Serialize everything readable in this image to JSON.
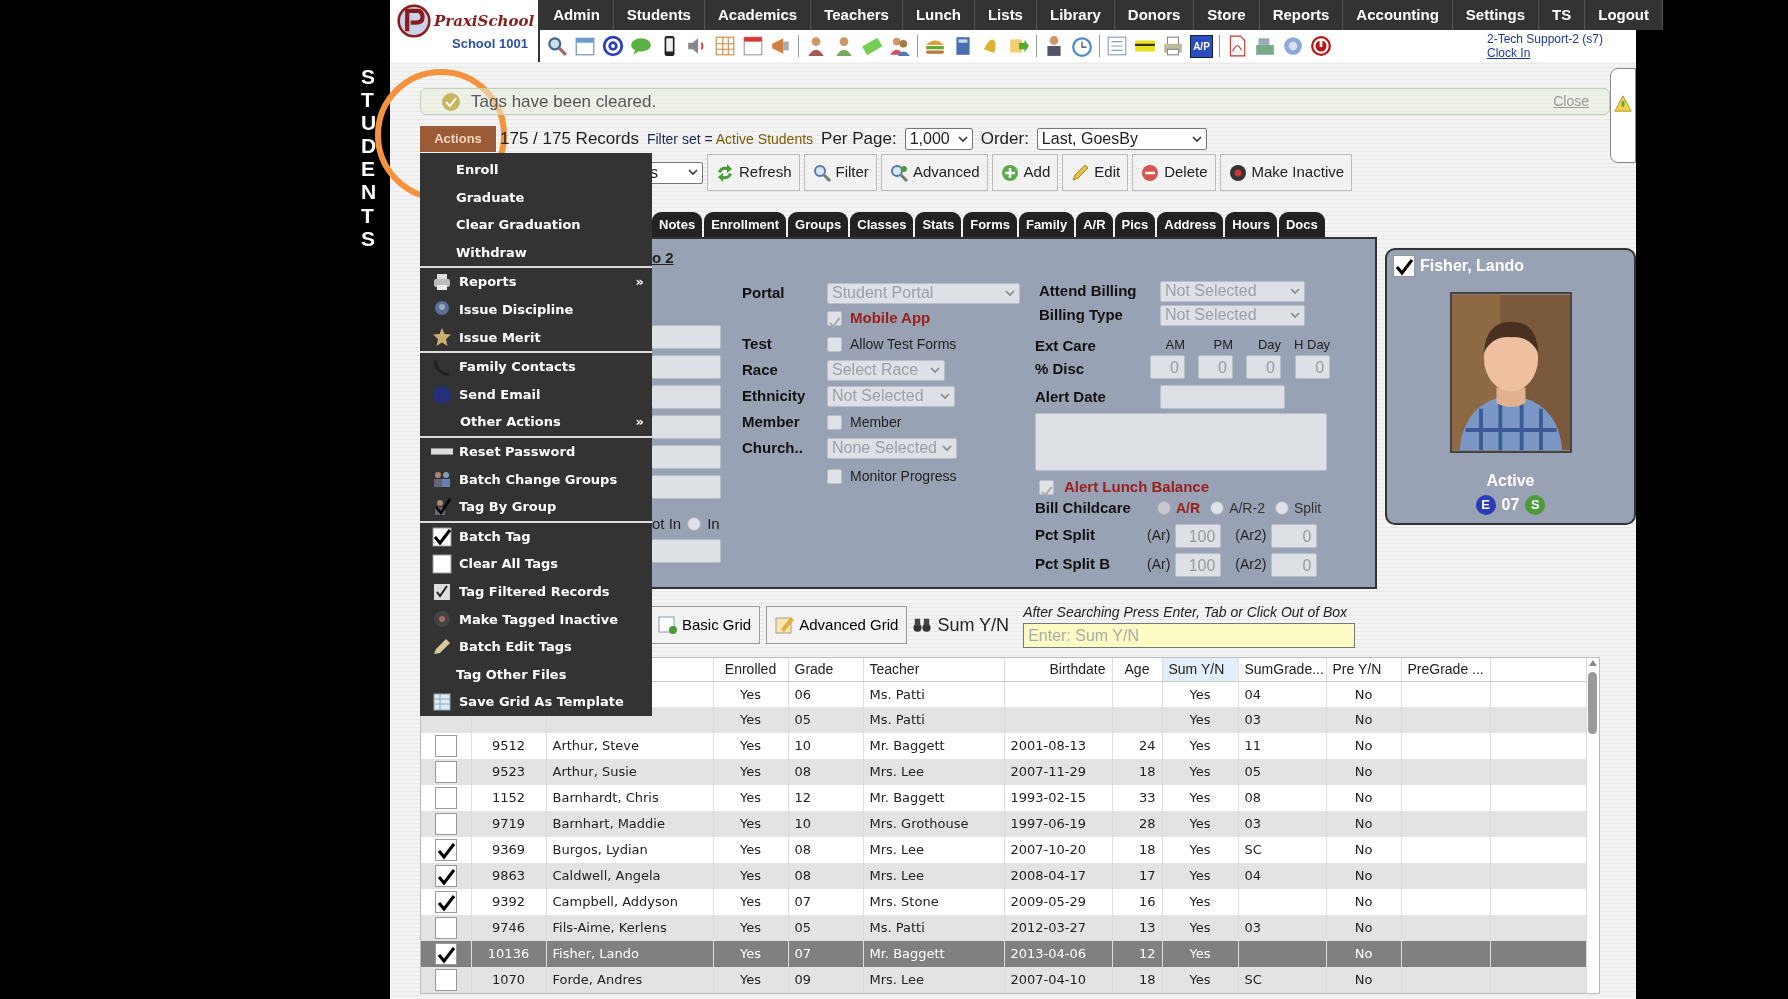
{
  "section_label": "STUDENTS",
  "logo": {
    "brand": "PraxiSchool",
    "school": "School 1001"
  },
  "nav": [
    "Admin",
    "Students",
    "Academics",
    "Teachers",
    "Lunch",
    "Lists",
    "Library",
    "Donors",
    "Store",
    "Reports",
    "Accounting",
    "Settings",
    "TS",
    "Logout"
  ],
  "toolbar": {
    "ap_label": "A/P"
  },
  "user": {
    "name": "2-Tech Support-2 (s7)",
    "clock_in": "Clock In"
  },
  "notification": {
    "message": "Tags have been cleared.",
    "close": "Close"
  },
  "records": {
    "actions": "Actions",
    "count": "175",
    "total": "/ 175 Records",
    "filter_label": "Filter set =",
    "filter_value": "Active Students",
    "per_page_label": "Per Page:",
    "per_page": "1,000",
    "order_label": "Order:",
    "order": "Last, GoesBy"
  },
  "view_select": "s",
  "buttons": [
    "Refresh",
    "Filter",
    "Advanced",
    "Add",
    "Edit",
    "Delete",
    "Make Inactive"
  ],
  "actions_menu": [
    [
      {
        "label": "Enroll"
      },
      {
        "label": "Graduate"
      },
      {
        "label": "Clear Graduation"
      },
      {
        "label": "Withdraw"
      }
    ],
    [
      {
        "label": "Reports",
        "arrow": "»"
      },
      {
        "label": "Issue Discipline"
      },
      {
        "label": "Issue Merit"
      }
    ],
    [
      {
        "label": "Family Contacts"
      },
      {
        "label": "Send Email"
      },
      {
        "label": "Other Actions",
        "arrow": "»"
      }
    ],
    [
      {
        "label": "Reset Password"
      },
      {
        "label": "Batch Change Groups"
      },
      {
        "label": "Tag By Group"
      }
    ],
    [
      {
        "label": "Batch Tag"
      },
      {
        "label": "Clear All Tags"
      },
      {
        "label": "Tag Filtered Records"
      },
      {
        "label": "Make Tagged Inactive"
      },
      {
        "label": "Batch Edit Tags"
      },
      {
        "label": "Tag Other Files"
      },
      {
        "label": "Save Grid As Template"
      }
    ]
  ],
  "tabs": [
    {
      "label": "Notes",
      "selected": false
    },
    {
      "label": "Enrollment",
      "selected": false
    },
    {
      "label": "Groups",
      "selected": false
    },
    {
      "label": "Classes",
      "selected": false
    },
    {
      "label": "Stats",
      "selected": false
    },
    {
      "label": "Forms",
      "selected": false
    },
    {
      "label": "Family",
      "selected": false
    },
    {
      "label": "A/R",
      "selected": false
    },
    {
      "label": "Pics",
      "selected": false
    },
    {
      "label": "Address",
      "selected": false
    },
    {
      "label": "Hours",
      "selected": false
    },
    {
      "label": "Docs",
      "selected": false
    }
  ],
  "panel": {
    "link": "o 2",
    "cut_label": "ot In",
    "cut_radio": {
      "label": "In",
      "selected": false
    },
    "fields": [
      {
        "kind": "select",
        "label": "Portal",
        "value": "Student Portal"
      },
      {
        "kind": "checkbox",
        "text": "Mobile App",
        "checked": true
      },
      {
        "kind": "checkbox",
        "label": "Test",
        "text": "Allow Test Forms",
        "checked": false
      },
      {
        "kind": "select",
        "label": "Race",
        "value": "Select Race"
      },
      {
        "kind": "select",
        "label": "Ethnicity",
        "value": "Not Selected"
      },
      {
        "kind": "checkbox",
        "label": "Member",
        "text": "Member",
        "checked": false
      },
      {
        "kind": "select",
        "label": "Church..",
        "value": "None Selected"
      },
      {
        "kind": "checkbox",
        "text": "Monitor Progress",
        "checked": false
      }
    ],
    "attend_billing": {
      "label": "Attend Billing",
      "value": "Not Selected"
    },
    "billing_type": {
      "label": "Billing Type",
      "value": "Not Selected"
    },
    "ext_care": {
      "label": "Ext Care",
      "label2": "% Disc",
      "columns": [
        {
          "heading": "AM",
          "value": "0"
        },
        {
          "heading": "PM",
          "value": "0"
        },
        {
          "heading": "Day",
          "value": "0"
        },
        {
          "heading": "H Day",
          "value": "0"
        }
      ]
    },
    "alert_date": {
      "label": "Alert Date"
    },
    "alert_lunch": {
      "text": "Alert Lunch Balance",
      "checked": true
    },
    "bill_childcare": {
      "label": "Bill Childcare",
      "options": [
        {
          "label": "A/R",
          "selected": true
        },
        {
          "label": "A/R-2",
          "selected": false
        },
        {
          "label": "Split",
          "selected": false
        }
      ]
    },
    "pct_rows": [
      {
        "label": "Pct Split",
        "fields": [
          {
            "prefix": "(Ar)",
            "value": "100"
          },
          {
            "prefix": "(Ar2)",
            "value": "0"
          }
        ]
      },
      {
        "label": "Pct Split B",
        "fields": [
          {
            "prefix": "(Ar)",
            "value": "100"
          },
          {
            "prefix": "(Ar2)",
            "value": "0"
          }
        ]
      }
    ]
  },
  "card": {
    "tagged": true,
    "name": "Fisher, Lando",
    "status": "Active",
    "codes": [
      {
        "kind": "badge",
        "text": "E",
        "color": "#2b3cb8"
      },
      {
        "kind": "text",
        "text": "07"
      },
      {
        "kind": "badge",
        "text": "S",
        "color": "#4c9a3a"
      }
    ]
  },
  "grid_buttons": [
    "Basic Grid",
    "Advanced Grid"
  ],
  "search": {
    "label": "Sum Y/N",
    "hint": "After Searching Press Enter, Tab or Click Out of Box",
    "placeholder": "Enter: Sum Y/N"
  },
  "columns": [
    {
      "label": "Enrolled",
      "sorted": false
    },
    {
      "label": "Grade",
      "sorted": false
    },
    {
      "label": "Teacher",
      "sorted": false
    },
    {
      "label": "Birthdate",
      "sorted": false
    },
    {
      "label": "Age",
      "sorted": false
    },
    {
      "label": "Sum Y/N",
      "sorted": true
    },
    {
      "label": "SumGrade...",
      "sorted": false
    },
    {
      "label": "Pre Y/N",
      "sorted": false
    },
    {
      "label": "PreGrade ...",
      "sorted": false
    }
  ],
  "rows": [
    {
      "enrolled": "Yes",
      "grade": "06",
      "teacher": "Ms. Patti",
      "sum_yn": "Yes",
      "sum_grade": "04",
      "pre_yn": "No",
      "selected": false
    },
    {
      "enrolled": "Yes",
      "grade": "05",
      "teacher": "Ms. Patti",
      "sum_yn": "Yes",
      "sum_grade": "03",
      "pre_yn": "No",
      "selected": false
    },
    {
      "tagged": false,
      "id": "9512",
      "name": "Arthur, Steve",
      "enrolled": "Yes",
      "grade": "10",
      "teacher": "Mr. Baggett",
      "birthdate": "2001-08-13",
      "age": "24",
      "sum_yn": "Yes",
      "sum_grade": "11",
      "pre_yn": "No",
      "selected": false
    },
    {
      "tagged": false,
      "id": "9523",
      "name": "Arthur, Susie",
      "enrolled": "Yes",
      "grade": "08",
      "teacher": "Mrs. Lee",
      "birthdate": "2007-11-29",
      "age": "18",
      "sum_yn": "Yes",
      "sum_grade": "05",
      "pre_yn": "No",
      "selected": false
    },
    {
      "tagged": false,
      "id": "1152",
      "name": "Barnhardt, Chris",
      "enrolled": "Yes",
      "grade": "12",
      "teacher": "Mr. Baggett",
      "birthdate": "1993-02-15",
      "age": "33",
      "sum_yn": "Yes",
      "sum_grade": "08",
      "pre_yn": "No",
      "selected": false
    },
    {
      "tagged": false,
      "id": "9719",
      "name": "Barnhart, Maddie",
      "enrolled": "Yes",
      "grade": "10",
      "teacher": "Mrs. Grothouse",
      "birthdate": "1997-06-19",
      "age": "28",
      "sum_yn": "Yes",
      "sum_grade": "03",
      "pre_yn": "No",
      "selected": false
    },
    {
      "tagged": true,
      "id": "9369",
      "name": "Burgos, Lydian",
      "enrolled": "Yes",
      "grade": "08",
      "teacher": "Mrs. Lee",
      "birthdate": "2007-10-20",
      "age": "18",
      "sum_yn": "Yes",
      "sum_grade": "SC",
      "pre_yn": "No",
      "selected": false
    },
    {
      "tagged": true,
      "id": "9863",
      "name": "Caldwell, Angela",
      "enrolled": "Yes",
      "grade": "08",
      "teacher": "Mrs. Lee",
      "birthdate": "2008-04-17",
      "age": "17",
      "sum_yn": "Yes",
      "sum_grade": "04",
      "pre_yn": "No",
      "selected": false
    },
    {
      "tagged": true,
      "id": "9392",
      "name": "Campbell, Addyson",
      "enrolled": "Yes",
      "grade": "07",
      "teacher": "Mrs. Stone",
      "birthdate": "2009-05-29",
      "age": "16",
      "sum_yn": "Yes",
      "pre_yn": "No",
      "selected": false
    },
    {
      "tagged": false,
      "id": "9746",
      "name": "Fils-Aime, Kerlens",
      "enrolled": "Yes",
      "grade": "05",
      "teacher": "Ms. Patti",
      "birthdate": "2012-03-27",
      "age": "13",
      "sum_yn": "Yes",
      "sum_grade": "03",
      "pre_yn": "No",
      "selected": false
    },
    {
      "tagged": true,
      "id": "10136",
      "name": "Fisher, Lando",
      "enrolled": "Yes",
      "grade": "07",
      "teacher": "Mr. Baggett",
      "birthdate": "2013-04-06",
      "age": "12",
      "sum_yn": "Yes",
      "pre_yn": "No",
      "selected": true
    },
    {
      "tagged": false,
      "id": "1070",
      "name": "Forde, Andres",
      "enrolled": "Yes",
      "grade": "09",
      "teacher": "Mrs. Lee",
      "birthdate": "2007-04-10",
      "age": "18",
      "sum_yn": "Yes",
      "sum_grade": "SC",
      "pre_yn": "No",
      "selected": false
    }
  ]
}
